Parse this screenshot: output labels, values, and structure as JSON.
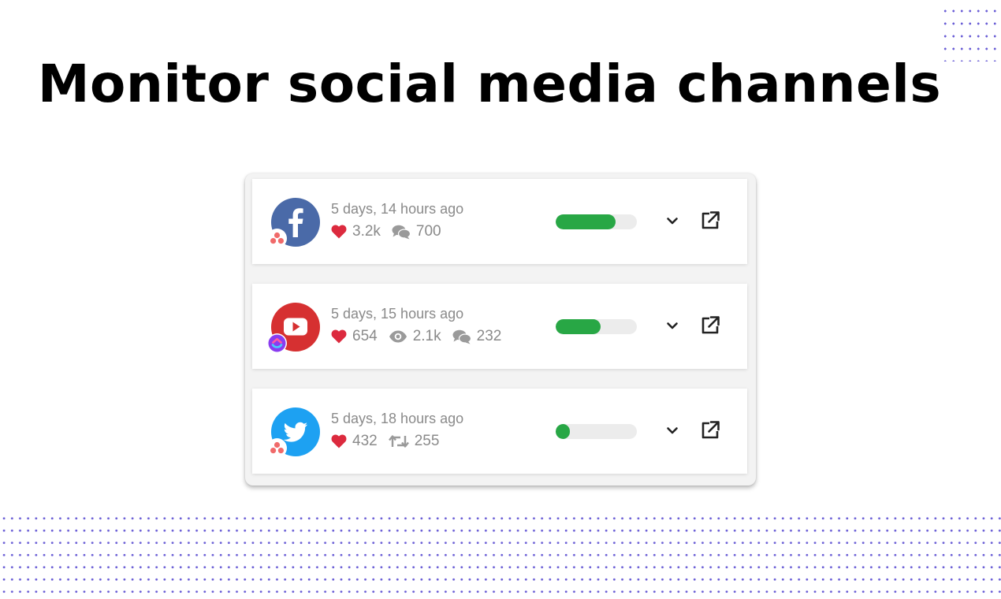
{
  "page": {
    "title": "Monitor social media channels",
    "accent_color": "#6b5fd6"
  },
  "posts": [
    {
      "network": "facebook",
      "network_icon": "facebook-logo-icon",
      "brand_color": "#4a6aa8",
      "badge_icon": "asana-icon",
      "time": "5 days, 14 hours ago",
      "stats": [
        {
          "icon": "heart-icon",
          "value": "3.2k"
        },
        {
          "icon": "comments-icon",
          "value": "700"
        }
      ],
      "progress": 0.74
    },
    {
      "network": "youtube",
      "network_icon": "youtube-logo-icon",
      "brand_color": "#d63031",
      "badge_icon": "clickup-icon",
      "time": "5 days, 15 hours ago",
      "stats": [
        {
          "icon": "heart-icon",
          "value": "654"
        },
        {
          "icon": "eye-icon",
          "value": "2.1k"
        },
        {
          "icon": "comments-icon",
          "value": "232"
        }
      ],
      "progress": 0.55
    },
    {
      "network": "twitter",
      "network_icon": "twitter-logo-icon",
      "brand_color": "#1da1f2",
      "badge_icon": "asana-icon",
      "time": "5 days, 18 hours ago",
      "stats": [
        {
          "icon": "heart-icon",
          "value": "432"
        },
        {
          "icon": "retweet-icon",
          "value": "255"
        }
      ],
      "progress": 0.17
    }
  ]
}
